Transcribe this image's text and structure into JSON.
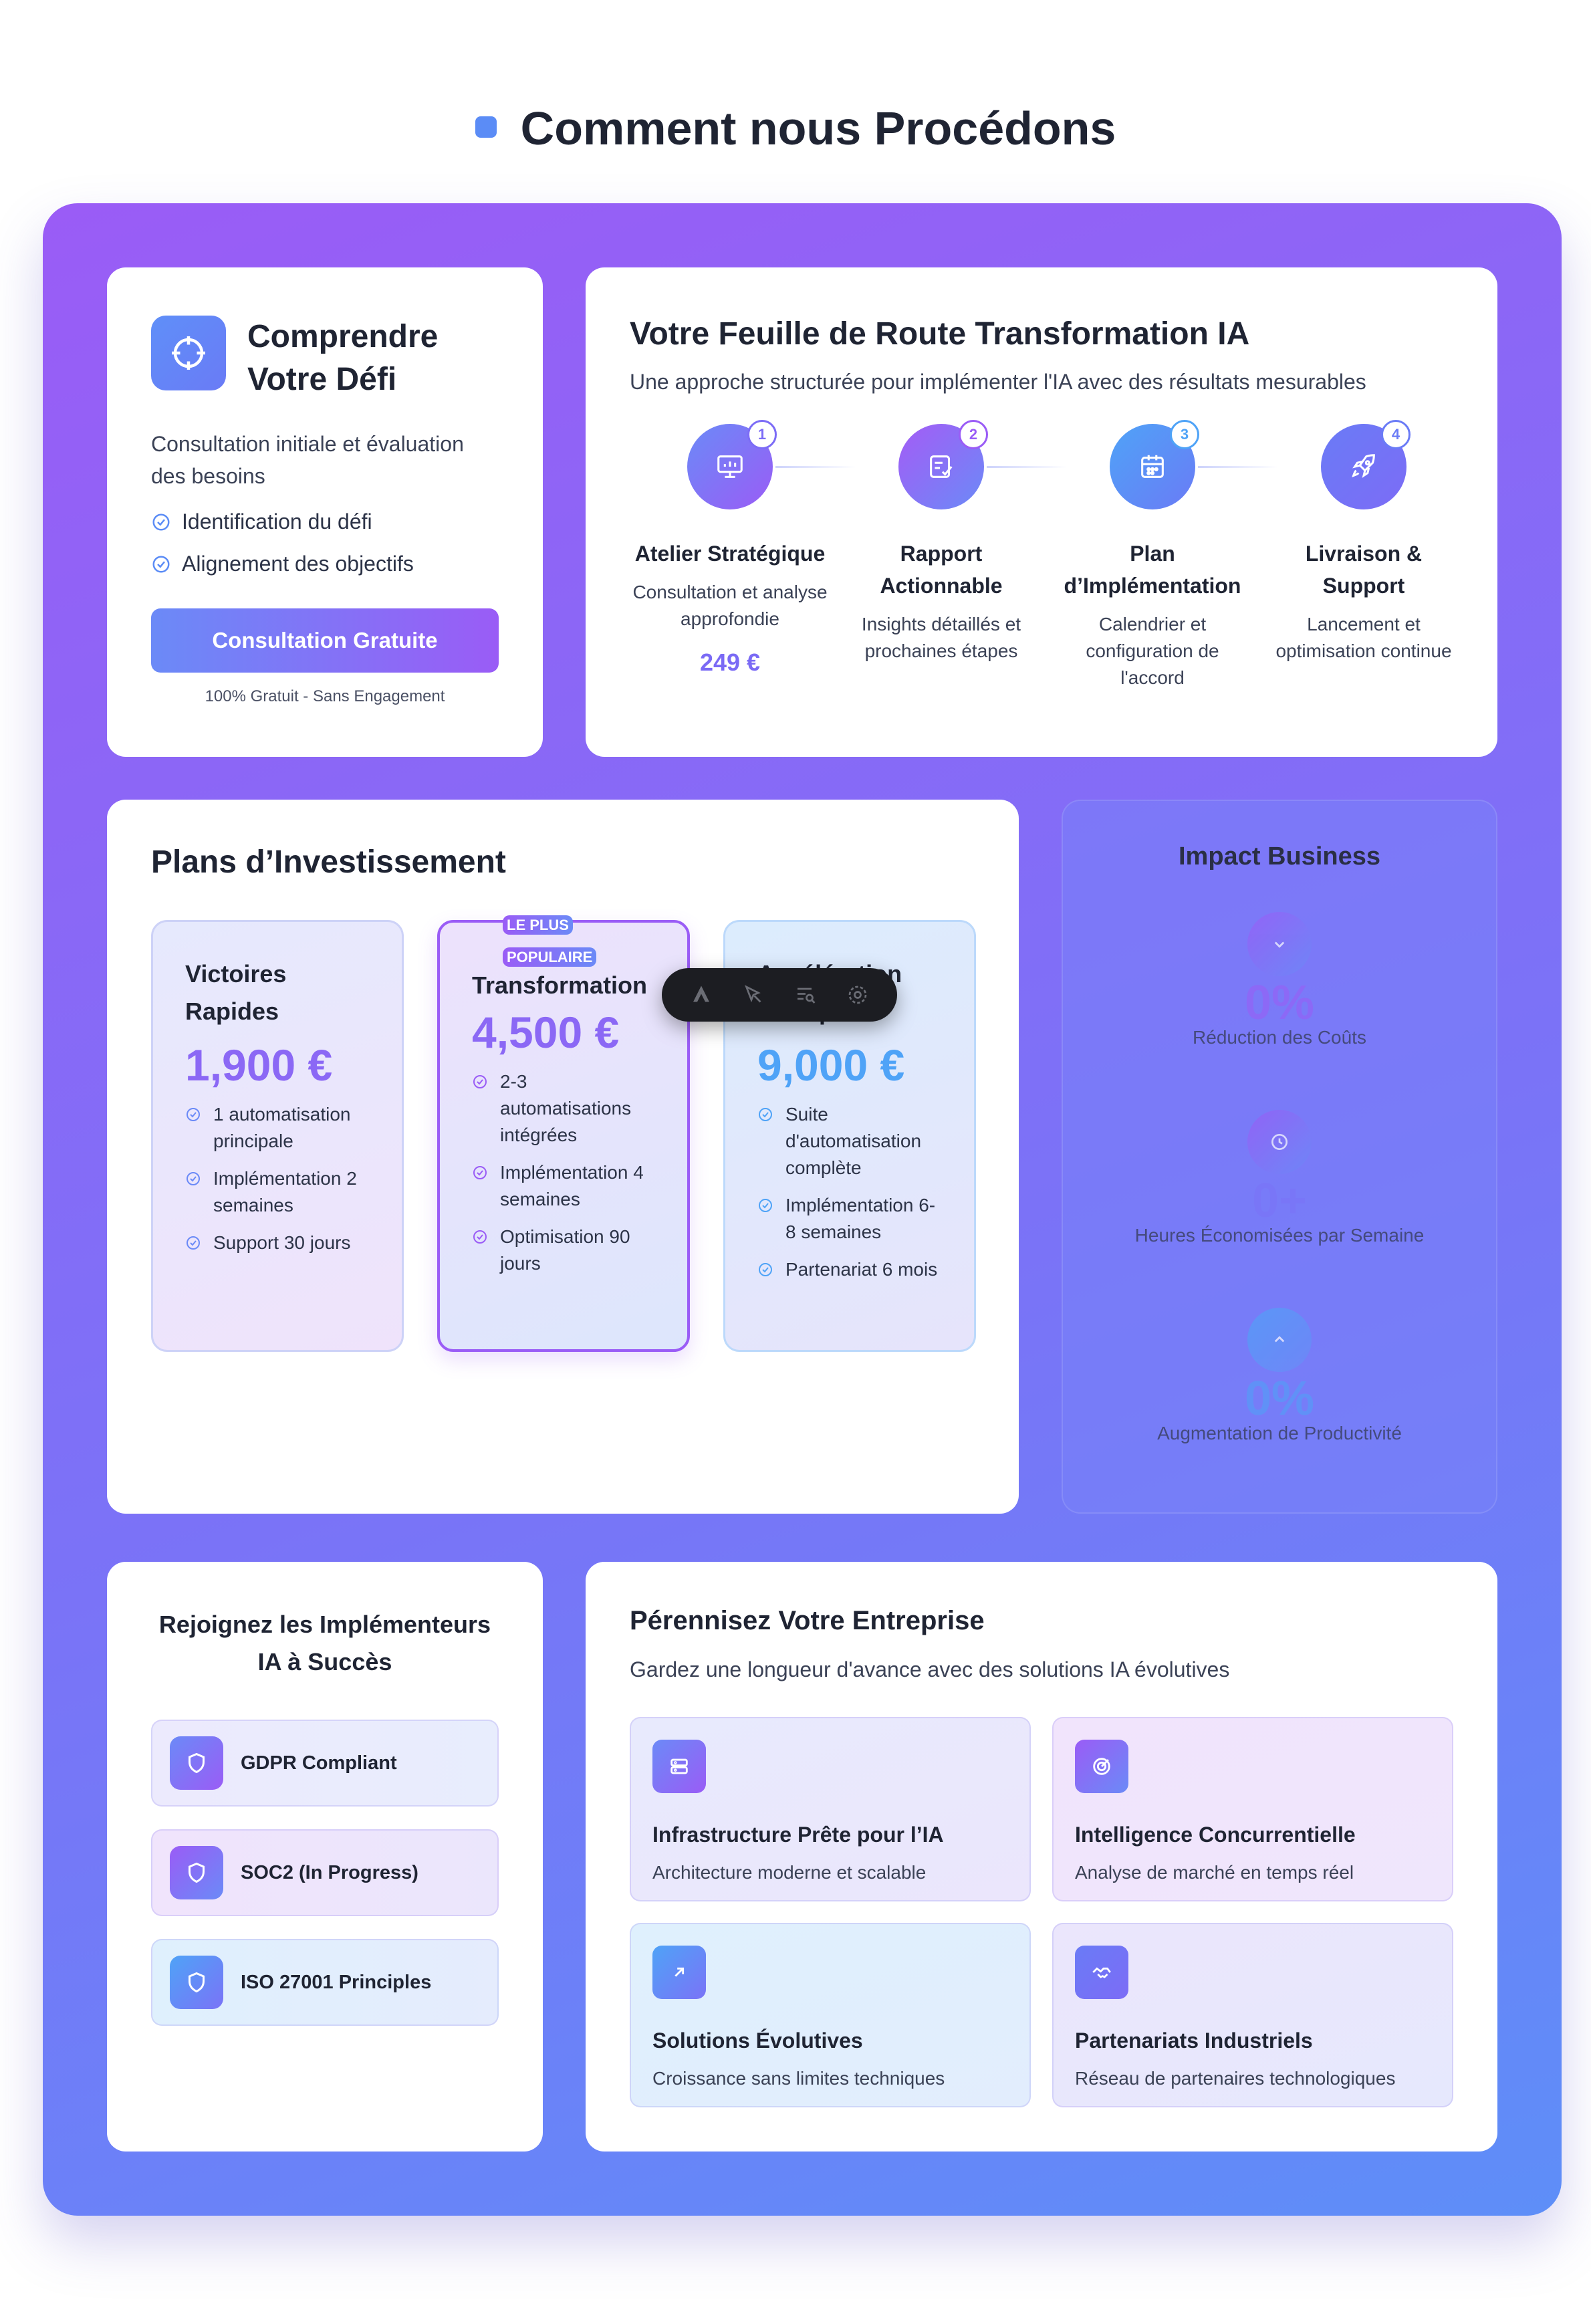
{
  "page": {
    "heading": "Comment nous Procédons"
  },
  "challenge": {
    "title": "Comprendre Votre Défi",
    "subtitle": "Consultation initiale et évaluation des besoins",
    "checks": [
      "Identification du défi",
      "Alignement des objectifs"
    ],
    "cta_label": "Consultation Gratuite",
    "note": "100% Gratuit - Sans Engagement"
  },
  "roadmap": {
    "title": "Votre Feuille de Route Transformation IA",
    "subtitle": "Une approche structurée pour implémenter l'IA avec des résultats mesurables",
    "steps": [
      {
        "number": "1",
        "name": "Atelier Stratégique",
        "desc": "Consultation et analyse approfondie",
        "price": "249 €",
        "icon": "presentation-icon"
      },
      {
        "number": "2",
        "name": "Rapport Actionnable",
        "desc": "Insights détaillés et prochaines étapes",
        "icon": "report-check-icon"
      },
      {
        "number": "3",
        "name": "Plan d’Implémentation",
        "desc": "Calendrier et configuration de l'accord",
        "icon": "calendar-icon"
      },
      {
        "number": "4",
        "name": "Livraison & Support",
        "desc": "Lancement et optimisation continue",
        "icon": "rocket-icon"
      }
    ]
  },
  "plans": {
    "title": "Plans d’Investissement",
    "popular_badge": [
      "LE PLUS",
      "POPULAIRE"
    ],
    "items": [
      {
        "name": "Victoires Rapides",
        "price": "1,900 €",
        "features": [
          "1 automatisation principale",
          "Implémentation 2 semaines",
          "Support 30 jours"
        ]
      },
      {
        "name": "Transformation",
        "price": "4,500 €",
        "features": [
          "2-3 automatisations intégrées",
          "Implémentation 4 semaines",
          "Optimisation 90 jours"
        ]
      },
      {
        "name": "Accélération Entreprise",
        "price": "9,000 €",
        "features": [
          "Suite d'automatisation complète",
          "Implémentation 6-8 semaines",
          "Partenariat 6 mois"
        ]
      }
    ]
  },
  "impact": {
    "title": "Impact Business",
    "metrics": [
      {
        "value": "0%",
        "label": "Réduction des Coûts",
        "icon": "chevron-down-icon"
      },
      {
        "value": "0+",
        "label": "Heures Économisées par Semaine",
        "icon": "clock-icon"
      },
      {
        "value": "0%",
        "label": "Augmentation de Productivité",
        "icon": "chevron-up-icon"
      }
    ]
  },
  "trust": {
    "title": "Rejoignez les Implémenteurs IA à Succès",
    "certs": [
      "GDPR Compliant",
      "SOC2 (In Progress)",
      "ISO 27001 Principles"
    ]
  },
  "future": {
    "title": "Pérennisez Votre Entreprise",
    "subtitle": "Gardez une longueur d'avance avec des solutions IA évolutives",
    "features": [
      {
        "title": "Infrastructure Prête pour l’IA",
        "desc": "Architecture moderne et scalable",
        "icon": "server-icon"
      },
      {
        "title": "Intelligence Concurrentielle",
        "desc": "Analyse de marché en temps réel",
        "icon": "target-icon"
      },
      {
        "title": "Solutions Évolutives",
        "desc": "Croissance sans limites techniques",
        "icon": "arrow-up-right-icon"
      },
      {
        "title": "Partenariats Industriels",
        "desc": "Réseau de partenaires technologiques",
        "icon": "handshake-icon"
      }
    ]
  },
  "colors": {
    "accent_blue": "#5b8cf6",
    "accent_purple": "#9a5cf6",
    "step1": "#7c6cf6",
    "step2": "#9a5cf6",
    "step3": "#4fa3f7",
    "step4": "#6a7bf6"
  }
}
